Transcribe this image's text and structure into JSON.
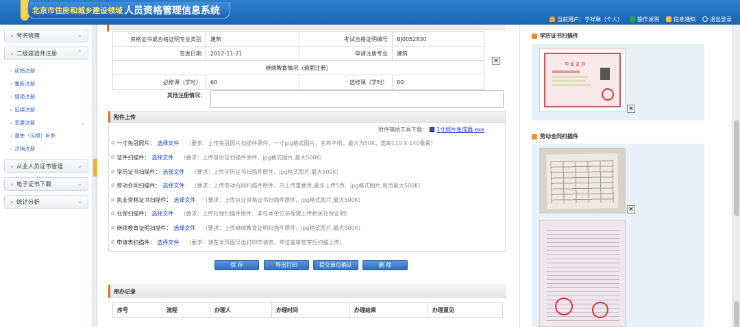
{
  "app": {
    "title_prefix": "北京市住房和城乡建设领域",
    "title_main": "人员资格管理信息系统"
  },
  "userbar": {
    "current_user": "当前用户：于祥琳（个人）",
    "help": "操作说明",
    "notice": "信息通知",
    "logout": "退出登录"
  },
  "sidebar": {
    "sections": [
      {
        "label": "考务管理"
      },
      {
        "label": "二级建造师注册"
      }
    ],
    "items": [
      {
        "label": "初始注册"
      },
      {
        "label": "重新注册"
      },
      {
        "label": "增项注册"
      },
      {
        "label": "延续注册"
      },
      {
        "label": "变更注册"
      },
      {
        "label": "遗失（污损）补办"
      },
      {
        "label": "注销注册"
      }
    ],
    "sections2": [
      {
        "label": "从业人员证书管理"
      },
      {
        "label": "电子证书下载"
      },
      {
        "label": "统计分析"
      }
    ]
  },
  "info_table": {
    "cert_type_label": "资格证书或合格证明专业类别",
    "cert_type_value": "建筑",
    "exam_no_label": "考试合格证明编号",
    "exam_no_value": "BJ0052830",
    "issue_date_label": "签发日期",
    "issue_date_value": "2012-11-21",
    "apply_major_label": "申请注册专业",
    "apply_major_value": "建筑",
    "cont_edu": "继续教育情况（逾期注册）",
    "required_label": "必修课（学时）",
    "required_value": "60",
    "elective_label": "选修课（学时）",
    "elective_value": "60",
    "other_label": "其他注册情况："
  },
  "attachments": {
    "header": "附件上传",
    "tool_label": "附件辅助工具下载：",
    "tool_link": "1寸照片生成器.exe",
    "select_label": "选择文件",
    "rows": [
      {
        "name": "一寸免冠照片：",
        "req": "（要求：上传免冠照片扫描件原件、一寸jpg格式图片，名称不限，最大为50K，宽高110 X 140像素）"
      },
      {
        "name": "证件扫描件：",
        "req": "（要求：上传身份证扫描件原件、jpg格式图片,最大500K）"
      },
      {
        "name": "学历证书扫描件：",
        "req": "（要求：上传学历证书扫描件原件、jpg格式图片,最大500K）"
      },
      {
        "name": "劳动合同扫描件：",
        "req": "（要求：上传劳动合同扫描件原件、只上传重要页,最多上传5页、jpg格式图片,每页最大500K）"
      },
      {
        "name": "执业资格证书扫描件：",
        "req": "（要求：上传执业资格证书扫描件原件、jpg格式图片,最大500K）"
      },
      {
        "name": "社保扫描件：",
        "req": "（要求：上传社保扫描件原件、非在本单位参保需上传相关社保证明）"
      },
      {
        "name": "继续教育证明扫描件：",
        "req": "（要求：上传继续教育证明扫描件原件、jpg格式图片,最大500K）"
      },
      {
        "name": "申请表扫描件：",
        "req": "（要求：请在本页面导出打印申请表，单位盖章签字后扫描上传）"
      }
    ]
  },
  "buttons": {
    "save": "保 存",
    "export": "导出打印",
    "submit": "提交单位确认",
    "delete": "删 除"
  },
  "audit": {
    "header": "审办记录",
    "columns": [
      "序号",
      "流程",
      "办理人",
      "办理时间",
      "办理结果",
      "办理意见"
    ]
  },
  "right_panel": {
    "edu_title": "学历证书扫描件",
    "contract_title": "劳动合同扫描件",
    "cert_caption": "毕 业 证 书"
  },
  "colors": {
    "header_blue": "#1a64b4",
    "accent_orange": "#e36b1b",
    "button_blue": "#2f6fc2",
    "panel_bg": "#e8f0f8"
  }
}
